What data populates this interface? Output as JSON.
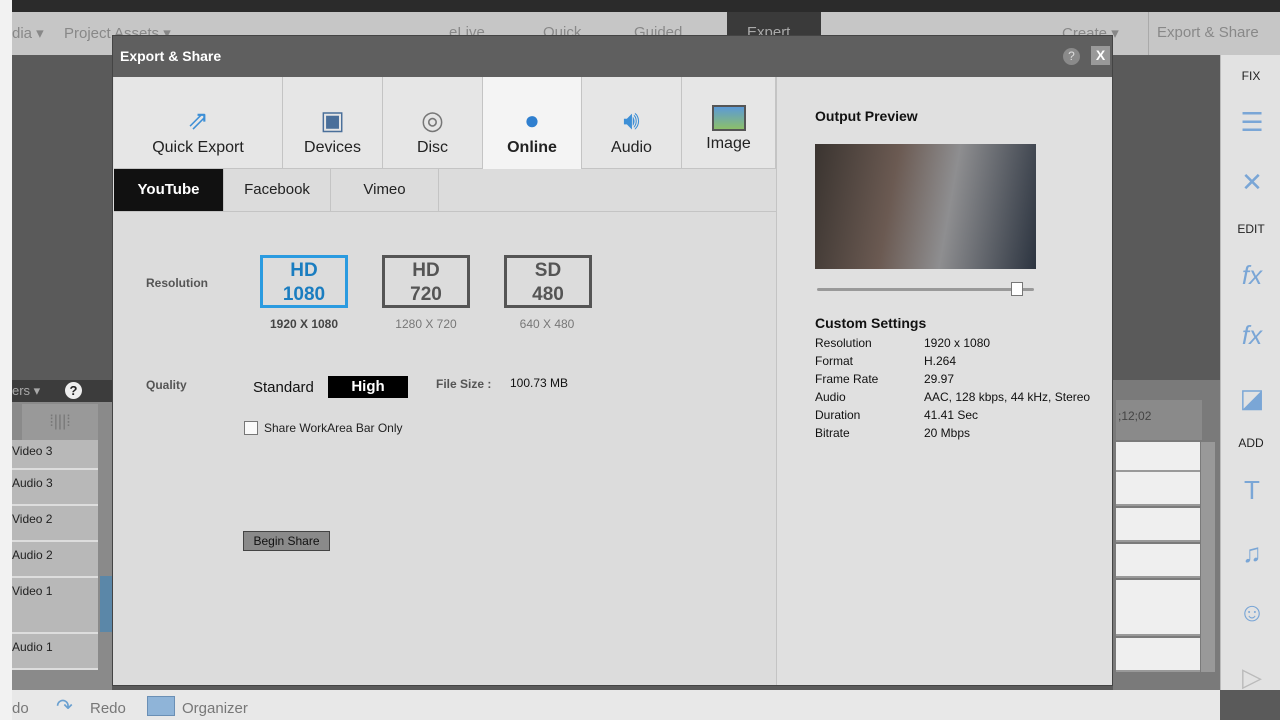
{
  "toolbar": {
    "media": "dia ▾",
    "project_assets": "Project Assets ▾",
    "elive": "eLive",
    "quick": "Quick",
    "guided": "Guided",
    "expert": "Expert",
    "create": "Create ▾",
    "export_share": "Export & Share"
  },
  "right_panel": {
    "fix": "FIX",
    "edit": "EDIT",
    "add": "ADD"
  },
  "timeline": {
    "menu": "ers ▾",
    "help": "?",
    "tracks": [
      "Video 3",
      "Audio 3",
      "Video 2",
      "Audio 2",
      "Video 1",
      "Audio 1"
    ],
    "timecode": ";12;02"
  },
  "bottom": {
    "undo": "do",
    "redo": "Redo",
    "organizer": "Organizer"
  },
  "dialog": {
    "title": "Export & Share",
    "help": "?",
    "close": "X",
    "tabs": [
      {
        "label": "Quick Export",
        "icon": "quick-export-icon"
      },
      {
        "label": "Devices",
        "icon": "devices-icon"
      },
      {
        "label": "Disc",
        "icon": "disc-icon"
      },
      {
        "label": "Online",
        "icon": "globe-icon"
      },
      {
        "label": "Audio",
        "icon": "speaker-icon"
      },
      {
        "label": "Image",
        "icon": "image-icon"
      }
    ],
    "selected_tab": "Online",
    "subtabs": [
      "YouTube",
      "Facebook",
      "Vimeo"
    ],
    "selected_subtab": "YouTube",
    "resolution_label": "Resolution",
    "resolutions": [
      {
        "top": "HD",
        "bottom": "1080",
        "dims": "1920 X 1080",
        "selected": true
      },
      {
        "top": "HD",
        "bottom": "720",
        "dims": "1280 X 720",
        "selected": false
      },
      {
        "top": "SD",
        "bottom": "480",
        "dims": "640 X 480",
        "selected": false
      }
    ],
    "quality_label": "Quality",
    "quality_standard": "Standard",
    "quality_high": "High",
    "quality_selected": "High",
    "file_size_label": "File Size :",
    "file_size": "100.73 MB",
    "workarea_checkbox": "Share WorkArea Bar Only",
    "workarea_checked": false,
    "begin_share": "Begin Share",
    "output_preview": "Output Preview",
    "preview_position": 0.92,
    "custom_settings": {
      "title": "Custom Settings",
      "rows": [
        {
          "k": "Resolution",
          "v": "1920 x 1080"
        },
        {
          "k": "Format",
          "v": "H.264"
        },
        {
          "k": "Frame Rate",
          "v": "29.97"
        },
        {
          "k": "Audio",
          "v": "AAC, 128 kbps, 44 kHz, Stereo"
        },
        {
          "k": "Duration",
          "v": "41.41 Sec"
        },
        {
          "k": "Bitrate",
          "v": "20 Mbps"
        }
      ]
    }
  },
  "colors": {
    "accent": "#2b9be0",
    "selected_black": "#111111"
  }
}
